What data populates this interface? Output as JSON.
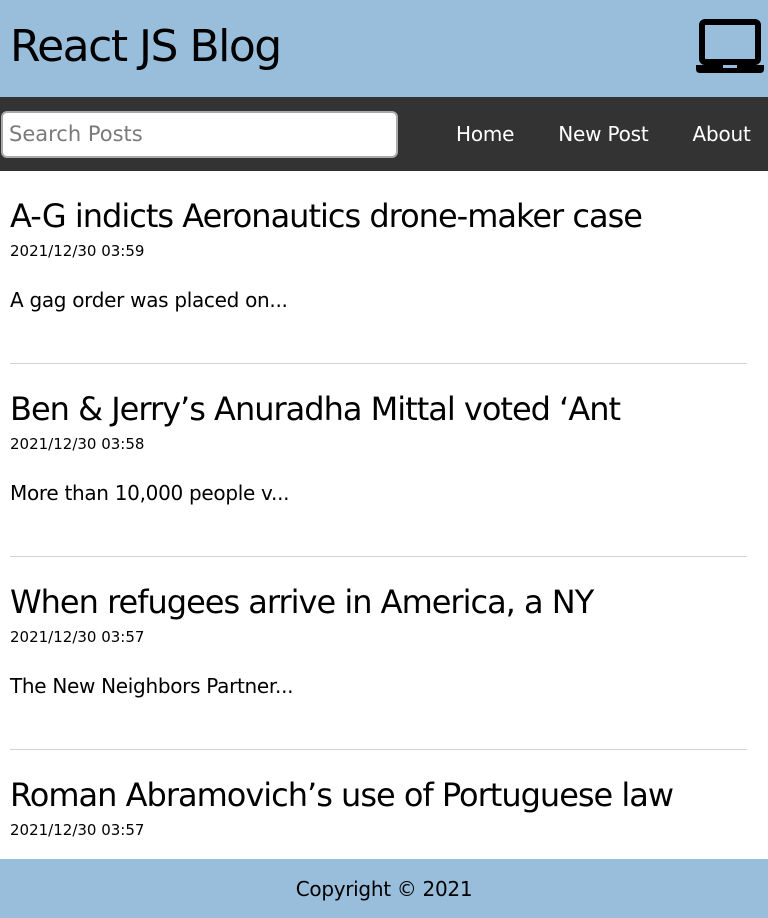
{
  "colors": {
    "header_bg": "#98bedc",
    "nav_bg": "#333333",
    "footer_bg": "#98bedc"
  },
  "header": {
    "title": "React JS Blog",
    "icon": "laptop-icon"
  },
  "nav": {
    "search_placeholder": "Search Posts",
    "search_value": "",
    "links": [
      {
        "label": "Home"
      },
      {
        "label": "New Post"
      },
      {
        "label": "About"
      }
    ]
  },
  "posts": [
    {
      "title": "A-G indicts Aeronautics drone-maker case",
      "datetime": "2021/12/30 03:59",
      "excerpt": "A gag order was placed on..."
    },
    {
      "title": "Ben & Jerry’s Anuradha Mittal voted ‘Ant",
      "datetime": "2021/12/30 03:58",
      "excerpt": "More than 10,000 people v..."
    },
    {
      "title": "When refugees arrive in America, a NY",
      "datetime": "2021/12/30 03:57",
      "excerpt": "The New Neighbors Partner..."
    },
    {
      "title": "Roman Abramovich’s use of Portuguese law",
      "datetime": "2021/12/30 03:57",
      "excerpt": ""
    }
  ],
  "footer": {
    "text": "Copyright © 2021"
  }
}
